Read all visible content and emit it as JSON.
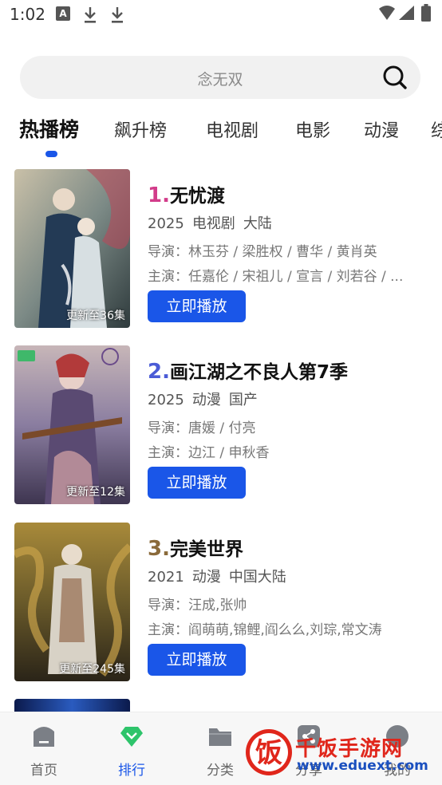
{
  "status_bar": {
    "time": "1:02",
    "a_glyph": "A"
  },
  "search": {
    "placeholder": "念无双"
  },
  "tabs": [
    {
      "label": "热播榜",
      "active": true
    },
    {
      "label": "飙升榜"
    },
    {
      "label": "电视剧"
    },
    {
      "label": "电影"
    },
    {
      "label": "动漫"
    },
    {
      "label": "综"
    }
  ],
  "items": [
    {
      "rank": "1.",
      "title": "无忧渡",
      "rank_color": "#d23c8a",
      "year": "2025",
      "genre": "电视剧",
      "region": "大陆",
      "director": "导演：林玉芬 / 梁胜权 / 曹华 / 黄肖英",
      "cast": "主演：任嘉伦 / 宋祖儿 / 宣言 / 刘若谷 / ...",
      "badge": "更新至36集",
      "play": "立即播放"
    },
    {
      "rank": "2.",
      "title": "画江湖之不良人第7季",
      "rank_color": "#4a5bd6",
      "year": "2025",
      "genre": "动漫",
      "region": "国产",
      "director": "导演：唐媛 / 付亮",
      "cast": "主演：边江 / 申秋香",
      "badge": "更新至12集",
      "play": "立即播放"
    },
    {
      "rank": "3.",
      "title": "完美世界",
      "rank_color": "#8a6a3a",
      "year": "2021",
      "genre": "动漫",
      "region": "中国大陆",
      "director": "导演：汪成,张帅",
      "cast": "主演：阎萌萌,锦鲤,阎么么,刘琮,常文涛",
      "badge": "更新至245集",
      "play": "立即播放"
    }
  ],
  "bottom_nav": [
    {
      "label": "首页",
      "icon": "home-icon"
    },
    {
      "label": "排行",
      "icon": "rank-diamond-icon",
      "active": true
    },
    {
      "label": "分类",
      "icon": "folder-icon"
    },
    {
      "label": "分享",
      "icon": "share-icon"
    },
    {
      "label": "我的",
      "icon": "profile-icon"
    }
  ],
  "watermark": {
    "title": "千饭手游网",
    "url": "www.eduext.com",
    "glyph": "饭"
  },
  "colors": {
    "accent": "#1a56e8",
    "watermark_red": "#e0261b"
  }
}
